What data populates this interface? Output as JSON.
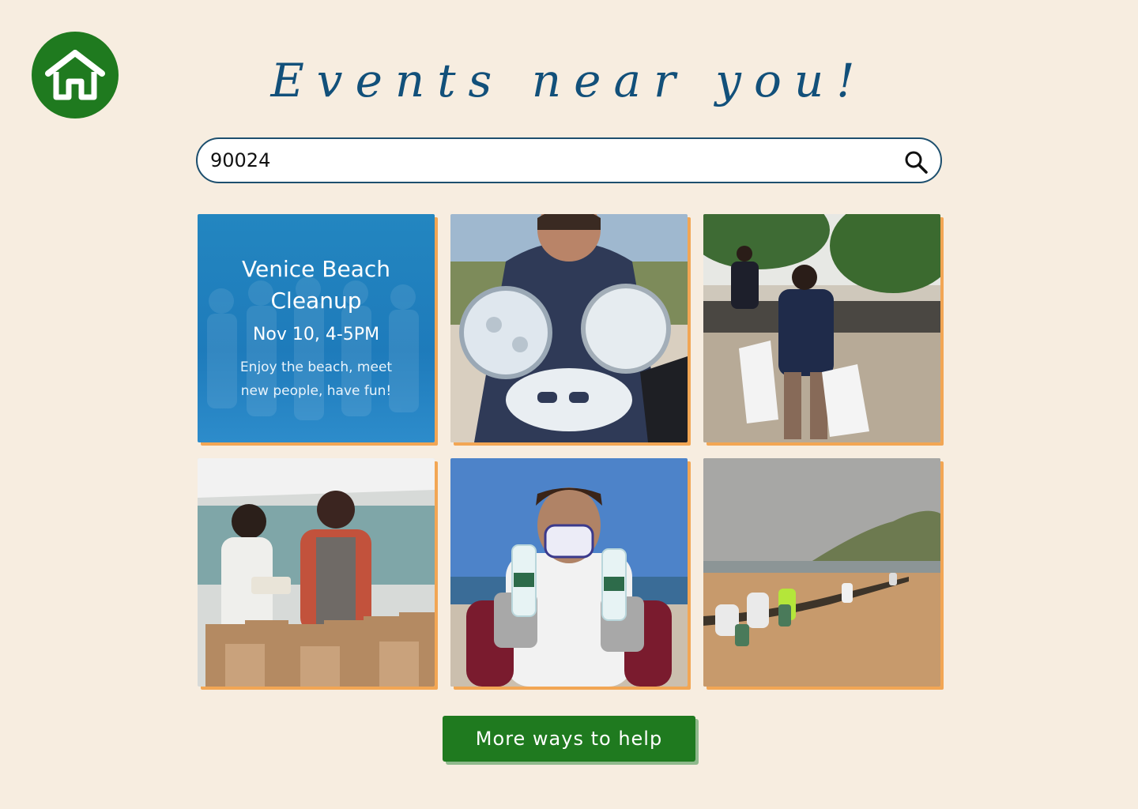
{
  "header": {
    "home_icon": "home-icon",
    "title": "Events near you!"
  },
  "search": {
    "value": "90024",
    "icon": "search-icon"
  },
  "featured_event": {
    "title": "Venice Beach Cleanup",
    "date": "Nov 10, 4-5PM",
    "description": "Enjoy the beach, meet new people, have fun!"
  },
  "photos": [
    {
      "subject": "volunteer-holding-plastic-lids"
    },
    {
      "subject": "volunteers-carrying-trash-bags"
    },
    {
      "subject": "volunteers-packing-bags"
    },
    {
      "subject": "volunteer-holding-bottles"
    },
    {
      "subject": "beach-cleanup-group"
    }
  ],
  "footer": {
    "more_label": "More ways to help"
  },
  "colors": {
    "background": "#f7ede0",
    "brand_green": "#1f7a1f",
    "title_blue": "#12507a",
    "card_blue": "#2386c0",
    "card_shadow": "#f2a654"
  }
}
